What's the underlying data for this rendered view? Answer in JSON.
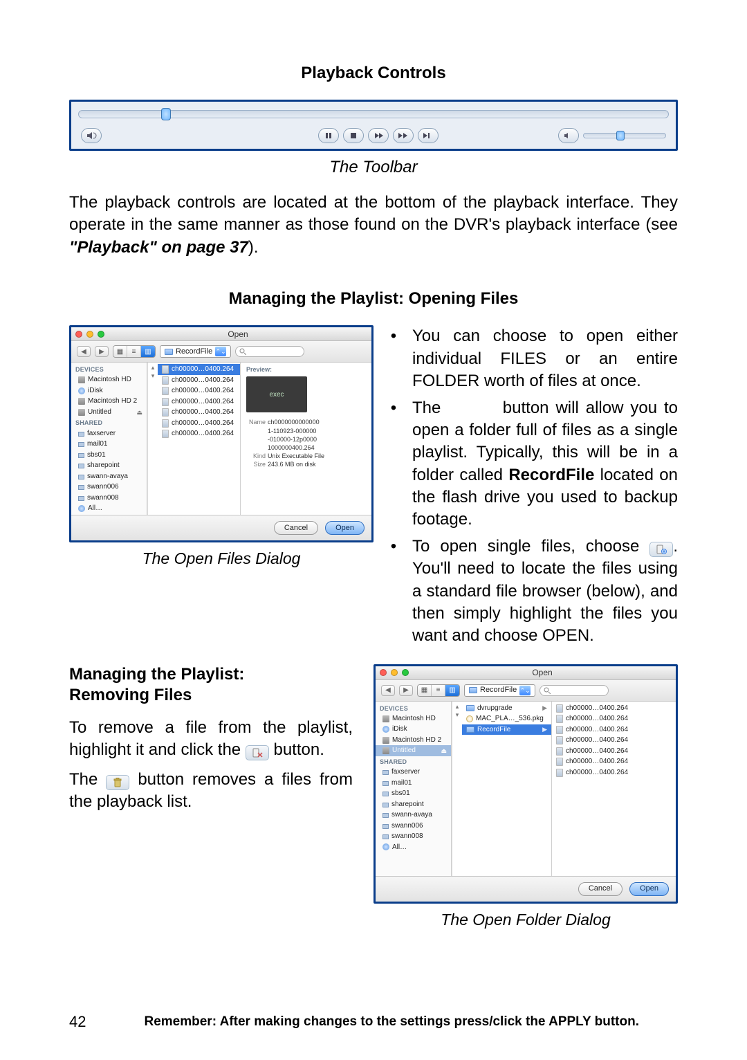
{
  "headings": {
    "playback_controls": "Playback Controls",
    "toolbar_caption": "The Toolbar",
    "opening_files": "Managing the Playlist: Opening Files",
    "open_files_caption": "The Open Files Dialog",
    "removing_files_l1": "Managing the Playlist:",
    "removing_files_l2": "Removing Files",
    "open_folder_caption": "The Open Folder Dialog"
  },
  "body": {
    "p1_a": "The playback controls are located at the bottom of the playback interface. They operate in the same manner as those found on the DVR's playback interface (see ",
    "p1_b": "\"Playback\" on page 37",
    "p1_c": ").",
    "b1": "You can choose to open either individual FILES or an entire FOLDER worth of files at once.",
    "b2_a": "The",
    "b2_b": "button will allow you to open a folder full of files as a single playlist. Typically, this will be in a folder called ",
    "b2_c": "RecordFile",
    "b2_d": " located on the flash drive you used to backup footage.",
    "b3_a": "To open single files, choose ",
    "b3_b": ". You'll need to locate the files using a standard file browser (below), and then simply highlight the files you want and choose OPEN.",
    "rem_p1_a": "To remove a file from the playlist, highlight it and click the ",
    "rem_p1_b": " button.",
    "rem_p2_a": "The ",
    "rem_p2_b": " button removes a files from the playback list."
  },
  "toolbar": {
    "btn1": "audio-settings",
    "btn_pause": "pause",
    "btn_stop": "stop",
    "btn_rew": "rewind",
    "btn_fwd": "fast-forward",
    "btn_next": "next",
    "vol_label": "volume"
  },
  "inline_icons": {
    "open_file": "open-file",
    "remove_file": "remove-file",
    "trash": "trash"
  },
  "dialog": {
    "title": "Open",
    "path": "RecordFile",
    "search_placeholder": "",
    "cancel": "Cancel",
    "open": "Open",
    "devices_hdr": "DEVICES",
    "shared_hdr": "SHARED",
    "devices": [
      "Macintosh HD",
      "iDisk",
      "Macintosh HD 2",
      "Untitled"
    ],
    "shared": [
      "faxserver",
      "mail01",
      "sbs01",
      "sharepoint",
      "swann-avaya",
      "swann006",
      "swann008"
    ],
    "all": "All…",
    "files": [
      "ch00000…0400.264",
      "ch00000…0400.264",
      "ch00000…0400.264",
      "ch00000…0400.264",
      "ch00000…0400.264",
      "ch00000…0400.264",
      "ch00000…0400.264"
    ],
    "preview_hdr": "Preview:",
    "preview_exec": "exec",
    "meta": {
      "name_k": "Name",
      "name_v1": "ch0000000000000",
      "name_v2": "1-110923-000000",
      "name_v3": "-010000-12p0000",
      "name_v4": "1000000400.264",
      "kind_k": "Kind",
      "kind_v": "Unix Executable File",
      "size_k": "Size",
      "size_v": "243.6 MB on disk"
    }
  },
  "dialog2": {
    "folders": [
      {
        "name": "dvrupgrade",
        "type": "folder"
      },
      {
        "name": "MAC_PLA…_536.pkg",
        "type": "pkg"
      },
      {
        "name": "RecordFile",
        "type": "folder",
        "selected": true
      }
    ],
    "files": [
      "ch00000…0400.264",
      "ch00000…0400.264",
      "ch00000…0400.264",
      "ch00000…0400.264",
      "ch00000…0400.264",
      "ch00000…0400.264",
      "ch00000…0400.264"
    ],
    "selected_device": "Untitled"
  },
  "footer": {
    "page": "42",
    "reminder": "Remember: After making changes to the settings press/click the APPLY button."
  }
}
